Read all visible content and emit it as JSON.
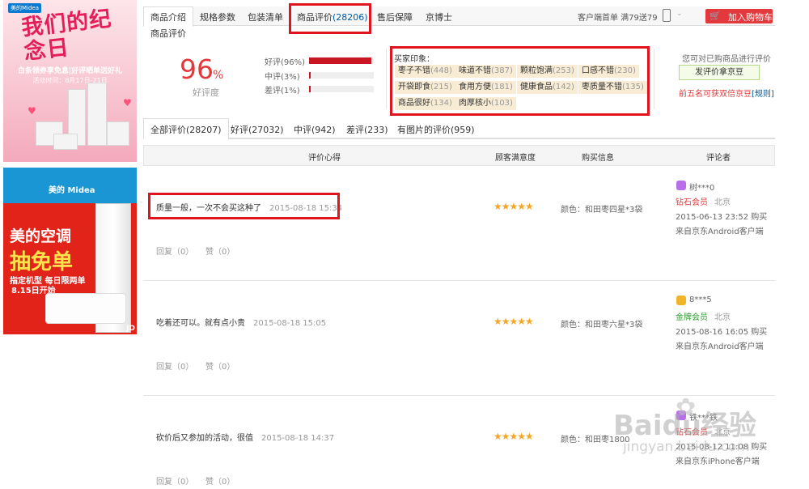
{
  "ads": {
    "ad1": {
      "brand": "美的Midea",
      "title": "我们的纪念日",
      "line1": "白条领券享免息|好评晒单送好礼",
      "line2": "活动时间：8月17日-21日"
    },
    "ad2": {
      "logo": "美的 Midea",
      "line1": "美的空调",
      "line2": "抽免单",
      "line3": "指定机型 每日限两单",
      "line4": "8.15日开始",
      "corner": "JD"
    }
  },
  "tabs": {
    "intro": "商品介绍",
    "specs": "规格参数",
    "package": "包装清单",
    "reviews_label": "商品评价",
    "reviews_count": "(28206)",
    "service": "售后保障",
    "doctor": "京博士",
    "mobile_offer": "客户端首单 满79送79",
    "add_cart": "加入购物车"
  },
  "summary": {
    "section_title": "商品评价",
    "rate": "96",
    "rate_sign": "%",
    "rate_label": "好评度",
    "bars": [
      {
        "label": "好评(96%)",
        "fraction": 0.96
      },
      {
        "label": "中评(3%)",
        "fraction": 0.03
      },
      {
        "label": "差评(1%)",
        "fraction": 0.01
      }
    ],
    "impression_title": "买家印象：",
    "tags": [
      {
        "text": "枣子不错",
        "count": "(448)"
      },
      {
        "text": "味道不错",
        "count": "(387)"
      },
      {
        "text": "颗粒饱满",
        "count": "(253)"
      },
      {
        "text": "口感不错",
        "count": "(230)"
      },
      {
        "text": "开袋即食",
        "count": "(215)"
      },
      {
        "text": "食用方便",
        "count": "(181)"
      },
      {
        "text": "健康食品",
        "count": "(142)"
      },
      {
        "text": "枣质量不错",
        "count": "(135)"
      },
      {
        "text": "商品很好",
        "count": "(134)"
      },
      {
        "text": "肉厚核小",
        "count": "(103)"
      }
    ],
    "can_review": "您可对已购商品进行评价",
    "review_button": "发评价拿京豆",
    "top5": "前五名可获双倍京豆",
    "rule": "[规则]"
  },
  "filters": [
    "全部评价(28207)",
    "好评(27032)",
    "中评(942)",
    "差评(233)",
    "有图片的评价(959)"
  ],
  "table": {
    "headers": [
      "评价心得",
      "顾客满意度",
      "购买信息",
      "评论者"
    ],
    "rows": [
      {
        "comment": "质量一般，一次不会买这种了",
        "date": "2015-08-18 15:34",
        "reply": "回复（0）",
        "like": "赞（0）",
        "stars": "★★★★★",
        "product": "颜色：和田枣四星*3袋",
        "user": "树***0",
        "level": "钻石会员",
        "level_color": "#e4393c",
        "city": "北京",
        "time": "2015-06-13 23:52 购买",
        "source": "来自京东Android客户端",
        "icon_color": "#b76ee8"
      },
      {
        "comment": "吃着还可以。就有点小贵",
        "date": "2015-08-18 15:05",
        "reply": "回复（0）",
        "like": "赞（0）",
        "stars": "★★★★★",
        "product": "颜色：和田枣六星*3袋",
        "user": "8***5",
        "level": "金牌会员",
        "level_color": "#2a9d2a",
        "city": "北京",
        "time": "2015-08-16 16:05 购买",
        "source": "来自京东Android客户端",
        "icon_color": "#f0b429"
      },
      {
        "comment": "砍价后又参加的活动，很值",
        "date": "2015-08-18 14:37",
        "reply": "回复（0）",
        "like": "赞（0）",
        "stars": "★★★★★",
        "product": "颜色：和田枣1800",
        "user": "铁***铁",
        "level": "钻石会员",
        "level_color": "#e4393c",
        "city": "北京",
        "time": "2015-08-12 11:08 购买",
        "source": "来自京东iPhone客户端",
        "icon_color": "#b76ee8"
      }
    ]
  },
  "watermark": {
    "main": "Baidu经验",
    "sub": "jingyan.baidu.com"
  }
}
